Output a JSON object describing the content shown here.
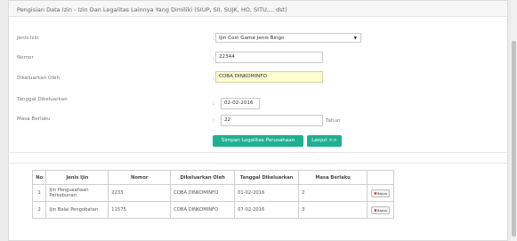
{
  "page": {
    "heading": "Pengisian Data Izin - Izin Dan Legalitas Lainnya Yang Dimiliki (SIUP, SII, SUJK, HO, SITU,... dst)"
  },
  "form": {
    "jenis_izin": {
      "label": "Jenis Izin",
      "colon": ":",
      "value": "Ijin Coin Game Jenis Bingo"
    },
    "nomor": {
      "label": "Nomor",
      "colon": ":",
      "value": "22344"
    },
    "dikeluarkan_oleh": {
      "label": "Dikeluarkan Oleh",
      "colon": ":",
      "value": "COBA DINKOMINFO"
    },
    "tanggal_dikeluarkan": {
      "label": "Tanggal Dikeluarkan",
      "colon": ":",
      "value": "02-02-2016"
    },
    "masa_berlaku": {
      "label": "Masa Berlaku",
      "colon": ":",
      "value": "22",
      "suffix": "Tahun"
    }
  },
  "buttons": {
    "simpan": "Simpan Legalitas Perusahaan",
    "lanjut": "Lanjut >>"
  },
  "table": {
    "headers": [
      "No",
      "Jenis Ijin",
      "Nomor",
      "Dikeluarkan Oleh",
      "Tanggal Dikeluarkan",
      "Masa Berlaku",
      ""
    ],
    "rows": [
      {
        "no": "1",
        "jenis": "Ijin Pengusahaan Perkebunan",
        "nomor": "2233",
        "oleh": "COBA DINKOMINFO",
        "tanggal": "01-02-2016",
        "masa": "2",
        "action": "Hapus"
      },
      {
        "no": "2",
        "jenis": "Ijin Balai Pengobatan",
        "nomor": "11575",
        "oleh": "COBA DINKOMINFO",
        "tanggal": "07-02-2016",
        "masa": "3",
        "action": "Hapus"
      }
    ]
  },
  "icons": {
    "delete": "x-icon",
    "dropdown": "caret-down-icon"
  },
  "colors": {
    "button": "#1fb08f",
    "highlight": "#fdfcd3",
    "delete_icon": "#dd0000"
  }
}
